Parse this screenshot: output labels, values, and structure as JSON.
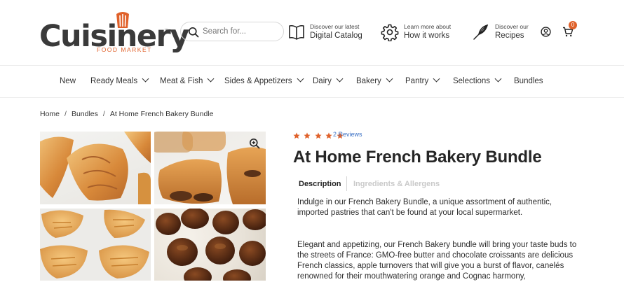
{
  "brand": {
    "name": "Cuisinery",
    "tagline": "FOOD MARKET",
    "tm": "™",
    "accent": "#e0612a"
  },
  "search": {
    "placeholder": "Search for..."
  },
  "promos": [
    {
      "small": "Discover our latest",
      "big": "Digital Catalog",
      "icon": "book-icon"
    },
    {
      "small": "Learn more about",
      "big": "How it works",
      "icon": "gear-icon"
    },
    {
      "small": "Discover our",
      "big": "Recipes",
      "icon": "whisk-icon"
    }
  ],
  "cart": {
    "count": "0"
  },
  "nav": [
    {
      "label": "New",
      "dropdown": false
    },
    {
      "label": "Ready Meals",
      "dropdown": true
    },
    {
      "label": "Meat & Fish",
      "dropdown": true
    },
    {
      "label": "Sides & Appetizers",
      "dropdown": true
    },
    {
      "label": "Dairy",
      "dropdown": true
    },
    {
      "label": "Bakery",
      "dropdown": true
    },
    {
      "label": "Pantry",
      "dropdown": true
    },
    {
      "label": "Selections",
      "dropdown": true
    },
    {
      "label": "Bundles",
      "dropdown": false
    }
  ],
  "breadcrumb": [
    "Home",
    "Bundles",
    "At Home French Bakery Bundle"
  ],
  "breadcrumb_sep": "/",
  "product": {
    "rating": 5,
    "rating_color": "#e0612a",
    "reviews": "2 Reviews",
    "title": "At Home French Bakery Bundle",
    "tabs": [
      "Description",
      "Ingredients & Allergens"
    ],
    "active_tab": "Description",
    "description": [
      "Indulge in our French Bakery Bundle, a unique assortment of authentic, imported pastries that can't be found at your local supermarket.",
      "Elegant and appetizing, our French Bakery bundle will bring your taste buds to the streets of France: GMO-free butter and chocolate croissants are delicious French classics, apple turnovers that will give you a burst of flavor, canelés renowned for their mouthwatering orange and Cognac harmony,"
    ]
  }
}
